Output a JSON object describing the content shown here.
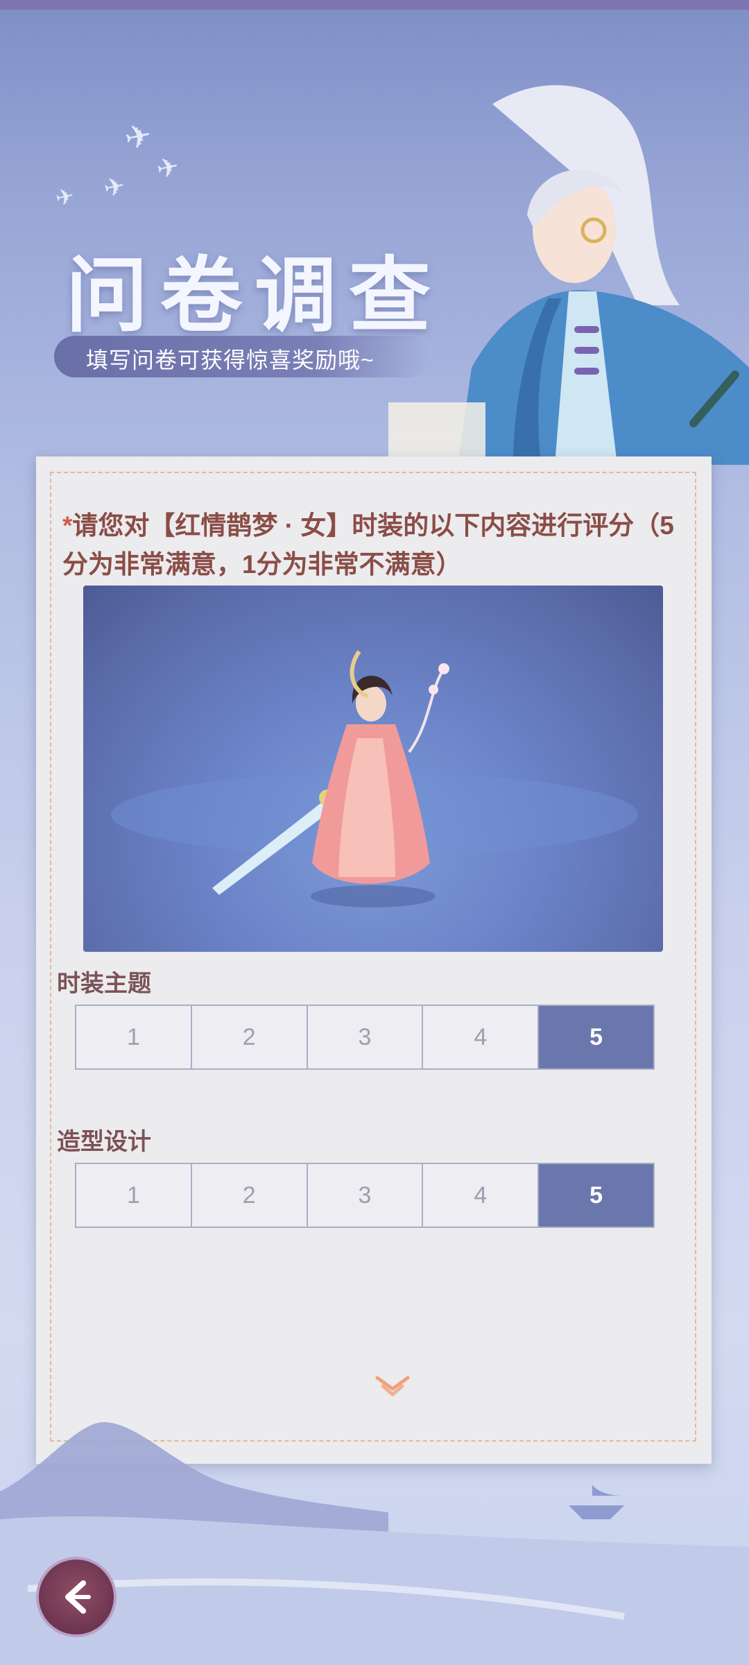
{
  "header": {
    "title": "问卷调查",
    "subtitle": "填写问卷可获得惊喜奖励哦~"
  },
  "question": {
    "asterisk": "*",
    "text": "请您对【红情鹊梦 · 女】时装的以下内容进行评分（5分为非常满意，1分为非常不满意）"
  },
  "ratings": [
    {
      "label": "时装主题",
      "options": [
        "1",
        "2",
        "3",
        "4",
        "5"
      ],
      "selected": "5"
    },
    {
      "label": "造型设计",
      "options": [
        "1",
        "2",
        "3",
        "4",
        "5"
      ],
      "selected": "5"
    }
  ],
  "icons": {
    "scroll": "double-chevron-down-icon",
    "back": "back-arrow-icon"
  },
  "colors": {
    "accent": "#6a77ad",
    "question_text": "#8a4d46",
    "label_text": "#7b5258",
    "card_bg": "#ecebee"
  }
}
